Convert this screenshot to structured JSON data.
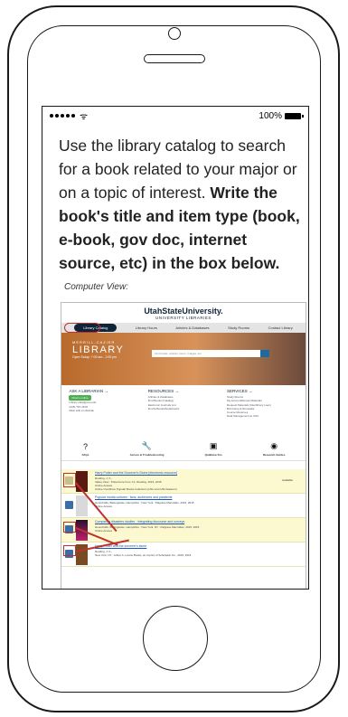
{
  "status": {
    "battery": "100%"
  },
  "instruction": {
    "plain": "Use the library catalog to search for a book related to your major or on a topic of interest. ",
    "bold": "Write the book's title and item type (book, e-book, gov doc, internet source, etc) in the box below."
  },
  "caption": "Computer View:",
  "site": {
    "name": "UtahStateUniversity.",
    "sub": "UNIVERSITY LIBRARIES",
    "nav": [
      "Library Catalog",
      "Library Hours",
      "Articles & Databases",
      "Study Rooms",
      "Contact Library"
    ],
    "logo_top": "MERRILL-CAZIER",
    "logo_main": "LIBRARY",
    "hours": "Open Today: 7:00 am - 2:00 pm",
    "search_placeholder": "Find books, articles, items, images, etc.",
    "cols": [
      {
        "title": "ASK A LIBRARIAN →",
        "lines": [
          "Chat is online",
          "Library Help@usu.edu",
          "(435) 797-2678",
          "Meet with a Librarian"
        ]
      },
      {
        "title": "RESOURCES →",
        "lines": [
          "Articles & Databases",
          "Find Books (Catalog)",
          "Electronic Journals List",
          "Find E-Books/Audiobooks"
        ]
      },
      {
        "title": "SERVICES →",
        "lines": [
          "Study Rooms",
          "My Account/Renew Materials",
          "Request Materials (Interlibrary Loan)",
          "Borrowing & Renewals",
          "Course Reserves",
          "Data Management at USU"
        ]
      }
    ],
    "icons": [
      {
        "glyph": "?",
        "label": "FAQs"
      },
      {
        "glyph": "🔧",
        "label": "Access & Troubleshooting"
      },
      {
        "glyph": "▣",
        "label": "QuikHow-Tos"
      },
      {
        "glyph": "◉",
        "label": "Research Guides"
      }
    ]
  },
  "results": [
    {
      "title": "Harry Potter and the Sorcerer's Stone [electronic resource]",
      "meta": "Rowling, J. K.,\nValley View : Pottermore from J.K. Rowling, 2015, 2015\nOnline Access\nOnline OverDrive Popular Books Collection (USU and USU Eastern)",
      "avail": "Available",
      "yellow": true
    },
    {
      "title": "Popular media cultures : fans, audiences and paratexts",
      "meta": "Houndmills, Basingstoke, Hampshire ; New York : Palgrave Macmillan, 2015, 2015\nOnline Access",
      "avail": "",
      "yellow": false
    },
    {
      "title": "Comparing disasters studies : integrating discourse and surveys",
      "meta": "Houndmills, Basingstoke, Hampshire ; New York, NY : Palgrave Macmillan, 2015, 2015\nOnline Access",
      "avail": "",
      "yellow": true
    },
    {
      "title": "Harry Potter and the sorcerer's stone",
      "meta": "Rowling, J. K.,\nNew York, NY : Arthur A. Levine Books, an imprint of Scholastic Inc., 2015, 2015",
      "avail": "",
      "yellow": false
    }
  ]
}
